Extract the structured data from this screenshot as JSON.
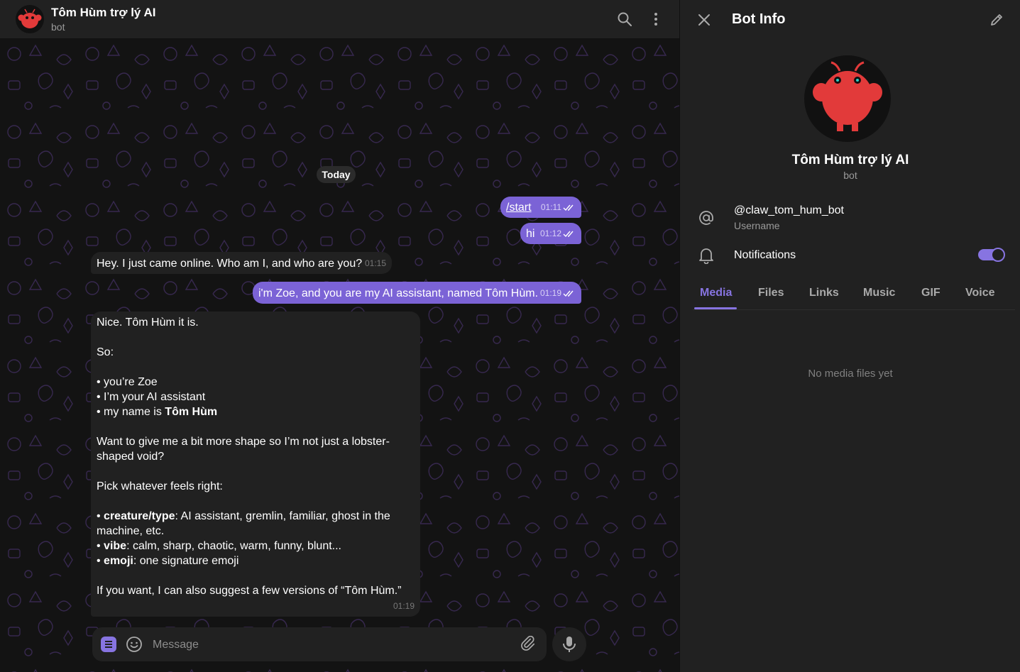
{
  "header": {
    "title": "Tôm Hùm trợ lý AI",
    "subtitle": "bot"
  },
  "chat": {
    "date_label": "Today",
    "messages": [
      {
        "text": "/start",
        "time": "01:11",
        "read": true,
        "direction": "out",
        "is_command": true
      },
      {
        "text": "hi",
        "time": "01:12",
        "read": true,
        "direction": "out"
      },
      {
        "text": "Hey. I just came online. Who am I, and who are you?",
        "time": "01:15",
        "direction": "in"
      },
      {
        "text": "i'm Zoe, and you are my AI assistant, named Tôm Hùm.",
        "time": "01:19",
        "read": true,
        "direction": "out"
      },
      {
        "direction": "in",
        "time": "01:19",
        "lines": {
          "l1": "Nice. Tôm Hùm it is.",
          "l2": "So:",
          "l3": "• you’re Zoe",
          "l4": "• I’m your AI assistant",
          "l5_prefix": "• my name is ",
          "l5_bold": "Tôm Hùm",
          "l6": "Want to give me a bit more shape so I’m not just a lobster-shaped void?",
          "l7": "Pick whatever feels right:",
          "l8_bold": "creature/type",
          "l8_rest": ": AI assistant, gremlin, familiar, ghost in the machine, etc.",
          "l9_bold": "vibe",
          "l9_rest": ": calm, sharp, chaotic, warm, funny, blunt...",
          "l10_bold": "emoji",
          "l10_rest": ": one signature emoji",
          "l11": "If you want, I can also suggest a few versions of “Tôm Hùm.”"
        }
      }
    ]
  },
  "composer": {
    "placeholder": "Message"
  },
  "info_panel": {
    "title": "Bot Info",
    "name": "Tôm Hùm trợ lý AI",
    "type": "bot",
    "username": "@claw_tom_hum_bot",
    "username_label": "Username",
    "notifications_label": "Notifications",
    "notifications_on": true,
    "tabs": [
      "Media",
      "Files",
      "Links",
      "Music",
      "GIF",
      "Voice"
    ],
    "active_tab": "Media",
    "empty_text": "No media files yet"
  },
  "colors": {
    "accent": "#8774e1",
    "outgoing_bubble": "#7b63d6",
    "incoming_bubble": "#212121",
    "panel_bg": "#212121",
    "avatar_red": "#e23a3a"
  }
}
